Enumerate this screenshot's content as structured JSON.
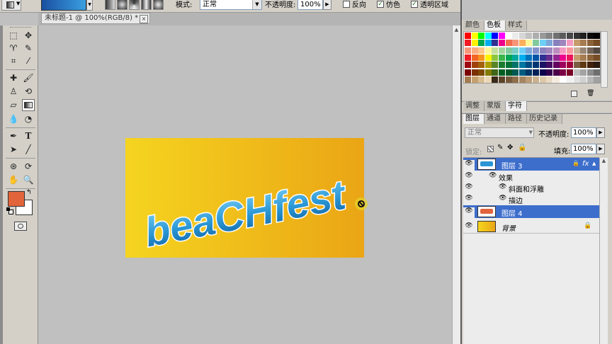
{
  "options_bar": {
    "mode_label": "模式:",
    "mode_value": "正常",
    "opacity_label": "不透明度:",
    "opacity_value": "100%",
    "reverse_label": "反向",
    "dither_label": "仿色",
    "transparency_label": "透明区域",
    "reverse_checked": false,
    "dither_checked": true,
    "transparency_checked": true,
    "gradient_colors": [
      "#1a4fa0",
      "#3aa0e0"
    ]
  },
  "document": {
    "tab_title": "未标题-1 @ 100%(RGB/8) *",
    "tab_close": "×",
    "canvas_text": "beaCHfest",
    "canvas_gradient": [
      "#f5d420",
      "#eaa515"
    ]
  },
  "toolbox": {
    "foreground_color": "#e2643a",
    "background_color": "#ffffff"
  },
  "color_panel": {
    "tabs": [
      "颜色",
      "色板",
      "样式"
    ],
    "active_tab": "色板",
    "swatches": [
      [
        "#ff0000",
        "#ffff00",
        "#00ff00",
        "#00ffff",
        "#0000ff",
        "#ff00ff",
        "#ffffff",
        "#ebebeb",
        "#d6d6d6",
        "#c2c2c2",
        "#adadad",
        "#999999",
        "#858585",
        "#707070",
        "#5c5c5c",
        "#474747",
        "#333333",
        "#1f1f1f",
        "#0a0a0a",
        "#000000"
      ],
      [
        "#ee1d24",
        "#fff200",
        "#00a650",
        "#00aeef",
        "#2e3192",
        "#ec008c",
        "#f26c4f",
        "#f69679",
        "#fbaf5d",
        "#fff799",
        "#82ca9c",
        "#6dcff6",
        "#7da7d9",
        "#8781bd",
        "#a186be",
        "#f49ac1",
        "#c69c6d",
        "#a67c52",
        "#8c6239",
        "#754c24"
      ],
      [
        "#f7977a",
        "#f9ad81",
        "#fdc68a",
        "#fff79a",
        "#c4df9b",
        "#a3d39c",
        "#82ca9d",
        "#7bcdc8",
        "#6ecff6",
        "#7ea7d8",
        "#8493ca",
        "#8882be",
        "#a187be",
        "#bc8dbf",
        "#f49ac2",
        "#f6989d",
        "#c7b299",
        "#998675",
        "#736357",
        "#534741"
      ],
      [
        "#ed1c24",
        "#f26522",
        "#f7941d",
        "#fff200",
        "#8dc63f",
        "#39b54a",
        "#00a651",
        "#00a99d",
        "#00aeef",
        "#0072bc",
        "#0054a6",
        "#2e3192",
        "#662d91",
        "#92278f",
        "#ec008c",
        "#ed145b",
        "#c69c6e",
        "#a67c52",
        "#8c6239",
        "#754c25"
      ],
      [
        "#9e0b0f",
        "#a0410d",
        "#a36209",
        "#aba000",
        "#598527",
        "#1a7b30",
        "#007236",
        "#00746b",
        "#0076a3",
        "#004b80",
        "#003471",
        "#1b1464",
        "#440e62",
        "#630460",
        "#9e005d",
        "#9e0039",
        "#7b5e42",
        "#603913",
        "#42210b",
        "#2b1a0e"
      ],
      [
        "#790000",
        "#7b2e00",
        "#7d4900",
        "#827b00",
        "#406618",
        "#005e20",
        "#005826",
        "#005952",
        "#005b7f",
        "#003663",
        "#002157",
        "#0d004c",
        "#32004b",
        "#4b0049",
        "#7b0046",
        "#7a0026",
        "#c0c0c0",
        "#a3a3a3",
        "#8c8c8c",
        "#6e6e6e"
      ],
      [
        "#a47b4f",
        "#c4a06e",
        "#d8bc91",
        "#ead7b6",
        "#3a2a18",
        "#5c4328",
        "#76583a",
        "#8f6f4a",
        "#a58560",
        "#bb9c76",
        "#cbb28f",
        "#dcc8a9",
        "#e9dac3",
        "#f4ebdc",
        "#ffffff",
        "#f0f0f0",
        "#e0e0e0",
        "#d0d0d0",
        "#b8b8b8",
        "#a0a0a0"
      ]
    ]
  },
  "adjust_panel": {
    "tabs": [
      "调整",
      "蒙版",
      "字符"
    ],
    "active_tab": "字符"
  },
  "layers_panel": {
    "tabs": [
      "图层",
      "通道",
      "路径",
      "历史记录"
    ],
    "active_tab": "图层",
    "blend_mode": "正常",
    "opacity_label": "不透明度:",
    "opacity_value": "100%",
    "lock_label": "锁定:",
    "fill_label": "填充:",
    "fill_value": "100%",
    "layers": [
      {
        "name": "图层 3",
        "selected": true,
        "fx": "fx"
      },
      {
        "name": "效果",
        "indent": 1
      },
      {
        "name": "斜面和浮雕",
        "indent": 2
      },
      {
        "name": "描边",
        "indent": 2
      },
      {
        "name": "图层 4",
        "selected": true
      },
      {
        "name": "背景",
        "italic": true,
        "locked": true
      }
    ]
  }
}
